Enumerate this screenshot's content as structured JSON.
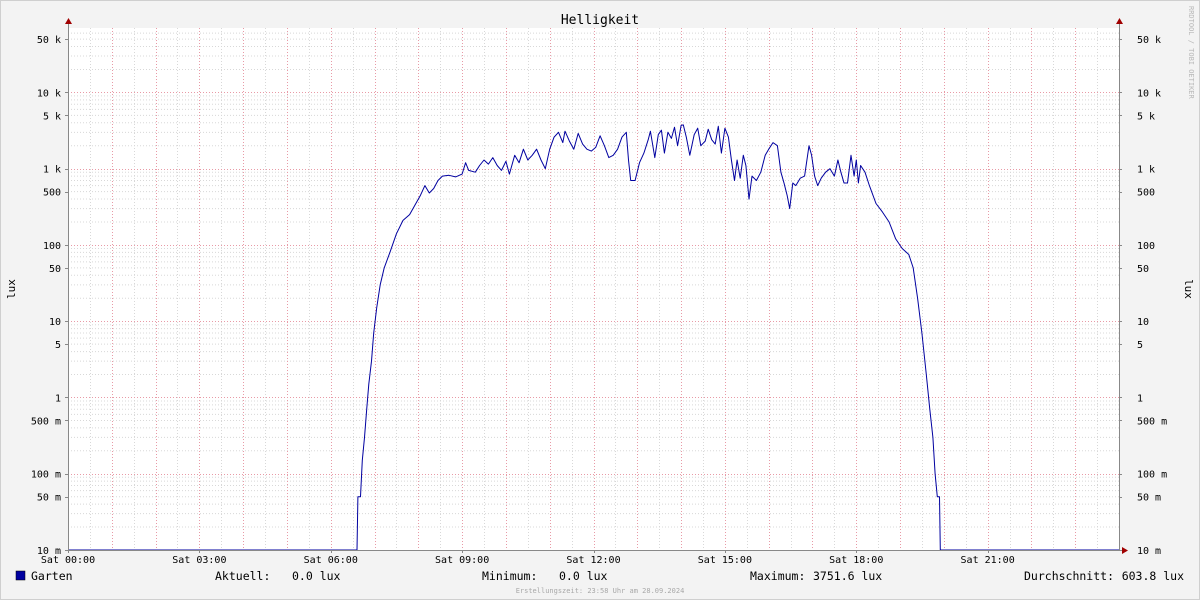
{
  "chart_data": {
    "type": "line",
    "title": "Helligkeit",
    "ylabel": "lux",
    "ylabel_right": "lux",
    "y_scale": "log",
    "ylim": [
      0.01,
      70000
    ],
    "y_ticks": [
      {
        "value": 50000,
        "label": "50 k"
      },
      {
        "value": 10000,
        "label": "10 k"
      },
      {
        "value": 5000,
        "label": "5 k"
      },
      {
        "value": 1000,
        "label": "1 k"
      },
      {
        "value": 500,
        "label": "500"
      },
      {
        "value": 100,
        "label": "100"
      },
      {
        "value": 50,
        "label": "50"
      },
      {
        "value": 10,
        "label": "10"
      },
      {
        "value": 5,
        "label": "5"
      },
      {
        "value": 1,
        "label": "1"
      },
      {
        "value": 0.5,
        "label": "500 m"
      },
      {
        "value": 0.1,
        "label": "100 m"
      },
      {
        "value": 0.05,
        "label": "50 m"
      },
      {
        "value": 0.01,
        "label": "10 m"
      }
    ],
    "x_unit": "hours",
    "xlim": [
      0,
      24
    ],
    "x_ticks": [
      {
        "value": 0,
        "label": "Sat 00:00"
      },
      {
        "value": 3,
        "label": "Sat 03:00"
      },
      {
        "value": 6,
        "label": "Sat 06:00"
      },
      {
        "value": 9,
        "label": "Sat 09:00"
      },
      {
        "value": 12,
        "label": "Sat 12:00"
      },
      {
        "value": 15,
        "label": "Sat 15:00"
      },
      {
        "value": 18,
        "label": "Sat 18:00"
      },
      {
        "value": 21,
        "label": "Sat 21:00"
      }
    ],
    "grid": true,
    "series": [
      {
        "name": "Garten",
        "color": "#0000a0",
        "points": [
          [
            0,
            0.01
          ],
          [
            6.6,
            0.01
          ],
          [
            6.62,
            0.05
          ],
          [
            6.68,
            0.05
          ],
          [
            6.72,
            0.15
          ],
          [
            6.77,
            0.3
          ],
          [
            6.82,
            0.7
          ],
          [
            6.87,
            1.5
          ],
          [
            6.93,
            3
          ],
          [
            6.98,
            7
          ],
          [
            7.05,
            15
          ],
          [
            7.13,
            30
          ],
          [
            7.22,
            50
          ],
          [
            7.35,
            80
          ],
          [
            7.5,
            140
          ],
          [
            7.65,
            210
          ],
          [
            7.8,
            250
          ],
          [
            7.92,
            330
          ],
          [
            8.05,
            450
          ],
          [
            8.15,
            600
          ],
          [
            8.25,
            480
          ],
          [
            8.35,
            550
          ],
          [
            8.45,
            700
          ],
          [
            8.55,
            800
          ],
          [
            8.7,
            820
          ],
          [
            8.85,
            780
          ],
          [
            9.0,
            850
          ],
          [
            9.08,
            1200
          ],
          [
            9.15,
            950
          ],
          [
            9.3,
            900
          ],
          [
            9.4,
            1100
          ],
          [
            9.5,
            1300
          ],
          [
            9.6,
            1150
          ],
          [
            9.7,
            1400
          ],
          [
            9.8,
            1100
          ],
          [
            9.9,
            950
          ],
          [
            10.0,
            1250
          ],
          [
            10.08,
            850
          ],
          [
            10.2,
            1500
          ],
          [
            10.3,
            1200
          ],
          [
            10.4,
            1800
          ],
          [
            10.5,
            1300
          ],
          [
            10.6,
            1500
          ],
          [
            10.7,
            1800
          ],
          [
            10.8,
            1300
          ],
          [
            10.9,
            1000
          ],
          [
            11.0,
            1800
          ],
          [
            11.1,
            2600
          ],
          [
            11.2,
            3000
          ],
          [
            11.3,
            2200
          ],
          [
            11.35,
            3100
          ],
          [
            11.45,
            2300
          ],
          [
            11.55,
            1800
          ],
          [
            11.65,
            2900
          ],
          [
            11.75,
            2100
          ],
          [
            11.85,
            1800
          ],
          [
            11.95,
            1700
          ],
          [
            12.05,
            1900
          ],
          [
            12.15,
            2700
          ],
          [
            12.25,
            2000
          ],
          [
            12.35,
            1400
          ],
          [
            12.45,
            1500
          ],
          [
            12.55,
            1800
          ],
          [
            12.65,
            2600
          ],
          [
            12.75,
            3000
          ],
          [
            12.8,
            1300
          ],
          [
            12.85,
            700
          ],
          [
            12.95,
            700
          ],
          [
            13.05,
            1200
          ],
          [
            13.15,
            1600
          ],
          [
            13.25,
            2400
          ],
          [
            13.3,
            3100
          ],
          [
            13.4,
            1400
          ],
          [
            13.48,
            2800
          ],
          [
            13.55,
            3200
          ],
          [
            13.62,
            1600
          ],
          [
            13.7,
            3000
          ],
          [
            13.78,
            2500
          ],
          [
            13.85,
            3500
          ],
          [
            13.92,
            2000
          ],
          [
            14.0,
            3700
          ],
          [
            14.05,
            3750
          ],
          [
            14.12,
            2600
          ],
          [
            14.2,
            1500
          ],
          [
            14.3,
            2800
          ],
          [
            14.38,
            3400
          ],
          [
            14.45,
            2000
          ],
          [
            14.55,
            2300
          ],
          [
            14.62,
            3300
          ],
          [
            14.7,
            2400
          ],
          [
            14.78,
            2100
          ],
          [
            14.85,
            3600
          ],
          [
            14.92,
            1600
          ],
          [
            15.0,
            3400
          ],
          [
            15.08,
            2600
          ],
          [
            15.15,
            1300
          ],
          [
            15.22,
            700
          ],
          [
            15.28,
            1300
          ],
          [
            15.35,
            750
          ],
          [
            15.42,
            1500
          ],
          [
            15.48,
            1100
          ],
          [
            15.55,
            400
          ],
          [
            15.62,
            800
          ],
          [
            15.72,
            700
          ],
          [
            15.82,
            900
          ],
          [
            15.92,
            1500
          ],
          [
            16.0,
            1800
          ],
          [
            16.1,
            2200
          ],
          [
            16.2,
            2000
          ],
          [
            16.28,
            900
          ],
          [
            16.35,
            650
          ],
          [
            16.42,
            450
          ],
          [
            16.48,
            300
          ],
          [
            16.55,
            650
          ],
          [
            16.62,
            600
          ],
          [
            16.72,
            750
          ],
          [
            16.82,
            800
          ],
          [
            16.92,
            2000
          ],
          [
            16.98,
            1500
          ],
          [
            17.05,
            800
          ],
          [
            17.12,
            600
          ],
          [
            17.2,
            750
          ],
          [
            17.3,
            900
          ],
          [
            17.4,
            1000
          ],
          [
            17.5,
            800
          ],
          [
            17.58,
            1300
          ],
          [
            17.65,
            900
          ],
          [
            17.72,
            650
          ],
          [
            17.8,
            650
          ],
          [
            17.88,
            1500
          ],
          [
            17.95,
            800
          ],
          [
            18.0,
            1300
          ],
          [
            18.05,
            650
          ],
          [
            18.1,
            1100
          ],
          [
            18.2,
            900
          ],
          [
            18.3,
            600
          ],
          [
            18.45,
            350
          ],
          [
            18.6,
            270
          ],
          [
            18.75,
            200
          ],
          [
            18.9,
            120
          ],
          [
            19.05,
            90
          ],
          [
            19.2,
            75
          ],
          [
            19.3,
            50
          ],
          [
            19.4,
            20
          ],
          [
            19.5,
            7
          ],
          [
            19.6,
            2
          ],
          [
            19.68,
            0.7
          ],
          [
            19.75,
            0.3
          ],
          [
            19.8,
            0.1
          ],
          [
            19.85,
            0.05
          ],
          [
            19.9,
            0.05
          ],
          [
            19.92,
            0.01
          ],
          [
            24,
            0.01
          ]
        ]
      }
    ],
    "legend_position": "bottom-left"
  },
  "legend": {
    "series_name": "Garten",
    "swatch_color": "#0000a0",
    "stats": [
      {
        "label": "Aktuell:",
        "value": "0.0 lux"
      },
      {
        "label": "Minimum:",
        "value": "0.0 lux"
      },
      {
        "label": "Maximum:",
        "value": "3751.6 lux"
      },
      {
        "label": "Durchschnitt:",
        "value": "603.8 lux"
      }
    ]
  },
  "footer": "Erstellungszeit: 23:58 Uhr am 28.09.2024",
  "watermark": "RRDTOOL / TOBI OETIKER",
  "colors": {
    "background": "#f3f3f3",
    "plot_background": "#ffffff",
    "major_grid": "#e89aa6",
    "minor_grid": "#d8d8d8",
    "line": "#0000a0",
    "axis": "#888888",
    "arrow": "#a00000"
  }
}
